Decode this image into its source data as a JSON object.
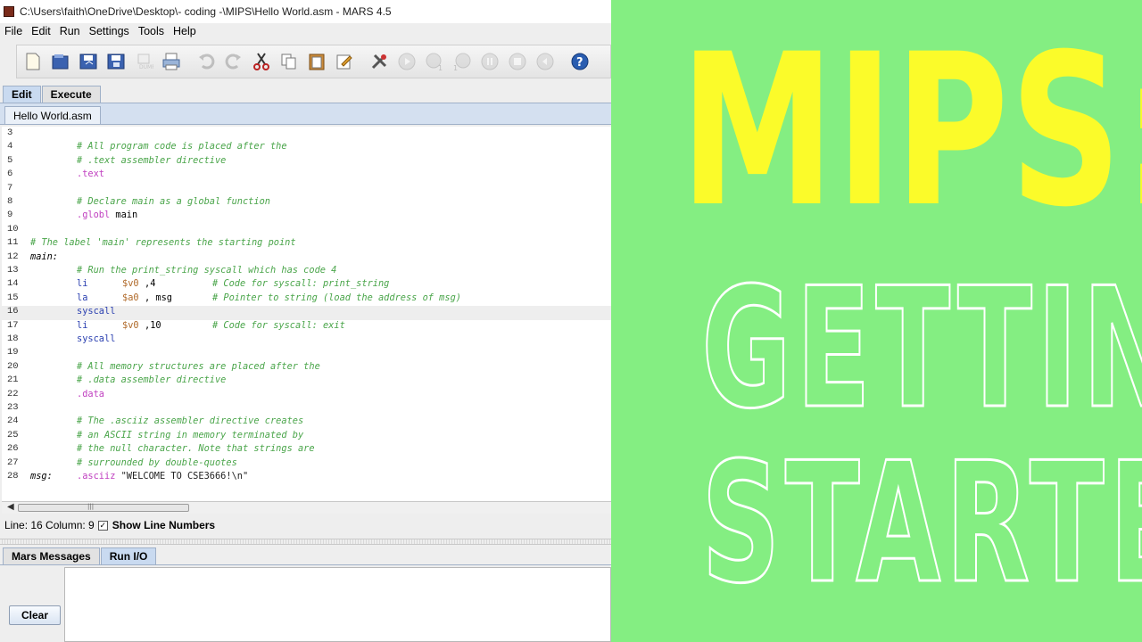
{
  "window": {
    "title": "C:\\Users\\faith\\OneDrive\\Desktop\\- coding -\\MIPS\\Hello World.asm  - MARS 4.5"
  },
  "menubar": {
    "items": [
      {
        "label": "File"
      },
      {
        "label": "Edit"
      },
      {
        "label": "Run"
      },
      {
        "label": "Settings"
      },
      {
        "label": "Tools"
      },
      {
        "label": "Help"
      }
    ]
  },
  "toolbar": {
    "buttons": [
      "new-file-icon",
      "open-file-icon",
      "save-icon",
      "save-as-icon",
      "dump-memory-icon",
      "print-icon",
      "undo-icon",
      "redo-icon",
      "cut-icon",
      "copy-icon",
      "paste-icon",
      "find-replace-icon",
      "assemble-icon",
      "run-icon",
      "step-icon",
      "backstep-icon",
      "pause-icon",
      "stop-icon",
      "reset-icon",
      "help-icon"
    ]
  },
  "tabs_top": [
    {
      "label": "Edit",
      "active": true
    },
    {
      "label": "Execute",
      "active": false
    }
  ],
  "file_tab": {
    "label": "Hello World.asm"
  },
  "editor": {
    "current_line": 16,
    "lines": [
      {
        "num": "3",
        "label": "",
        "instr": "",
        "args": "",
        "comment": "",
        "indent": 0
      },
      {
        "num": "4",
        "comment": "# All program code is placed after the",
        "indent": 1
      },
      {
        "num": "5",
        "comment": "# .text assembler directive",
        "indent": 1
      },
      {
        "num": "6",
        "directive": ".text",
        "indent": 1
      },
      {
        "num": "7",
        "indent": 0
      },
      {
        "num": "8",
        "comment": "# Declare main as a global function",
        "indent": 1
      },
      {
        "num": "9",
        "directive": ".globl",
        "args": " main",
        "indent": 1
      },
      {
        "num": "10",
        "indent": 0
      },
      {
        "num": "11",
        "comment": "# The label 'main' represents the starting point",
        "indent": 0
      },
      {
        "num": "12",
        "label": "main:",
        "indent": 0
      },
      {
        "num": "13",
        "comment": "# Run the print_string syscall which has code 4",
        "indent": 1
      },
      {
        "num": "14",
        "instr": "li",
        "reg": "$v0",
        "args": ",4",
        "comment": "# Code for syscall: print_string",
        "indent": 1
      },
      {
        "num": "15",
        "instr": "la",
        "reg": "$a0",
        "args": ", msg",
        "comment": "# Pointer to string (load the address of msg)",
        "indent": 1
      },
      {
        "num": "16",
        "instr": "syscall",
        "indent": 1
      },
      {
        "num": "17",
        "instr": "li",
        "reg": "$v0",
        "args": ",10",
        "comment": "# Code for syscall: exit",
        "indent": 1
      },
      {
        "num": "18",
        "instr": "syscall",
        "indent": 1
      },
      {
        "num": "19",
        "indent": 0
      },
      {
        "num": "20",
        "comment": "# All memory structures are placed after the",
        "indent": 1
      },
      {
        "num": "21",
        "comment": "# .data assembler directive",
        "indent": 1
      },
      {
        "num": "22",
        "directive": ".data",
        "indent": 1
      },
      {
        "num": "23",
        "indent": 0
      },
      {
        "num": "24",
        "comment": "# The .asciiz assembler directive creates",
        "indent": 1
      },
      {
        "num": "25",
        "comment": "# an ASCII string in memory terminated by",
        "indent": 1
      },
      {
        "num": "26",
        "comment": "# the null character. Note that strings are",
        "indent": 1
      },
      {
        "num": "27",
        "comment": "# surrounded by double-quotes",
        "indent": 1
      },
      {
        "num": "28",
        "label": "msg:",
        "directive": ".asciiz",
        "args": " \"WELCOME TO CSE3666!\\n\"",
        "indent": 0
      }
    ]
  },
  "status": {
    "position": "Line: 16 Column: 9",
    "show_line_numbers_label": "Show Line Numbers",
    "show_line_numbers_checked": true
  },
  "tabs_bottom": [
    {
      "label": "Mars Messages",
      "active": false
    },
    {
      "label": "Run I/O",
      "active": true
    }
  ],
  "messages": {
    "clear_label": "Clear"
  },
  "banner": {
    "line1": "MIPS:",
    "line2": "GETTING",
    "line3": "STARTED",
    "colors": {
      "background": "#84ee82",
      "line1": "#fbfb2a",
      "outline": "#ffffff"
    }
  }
}
